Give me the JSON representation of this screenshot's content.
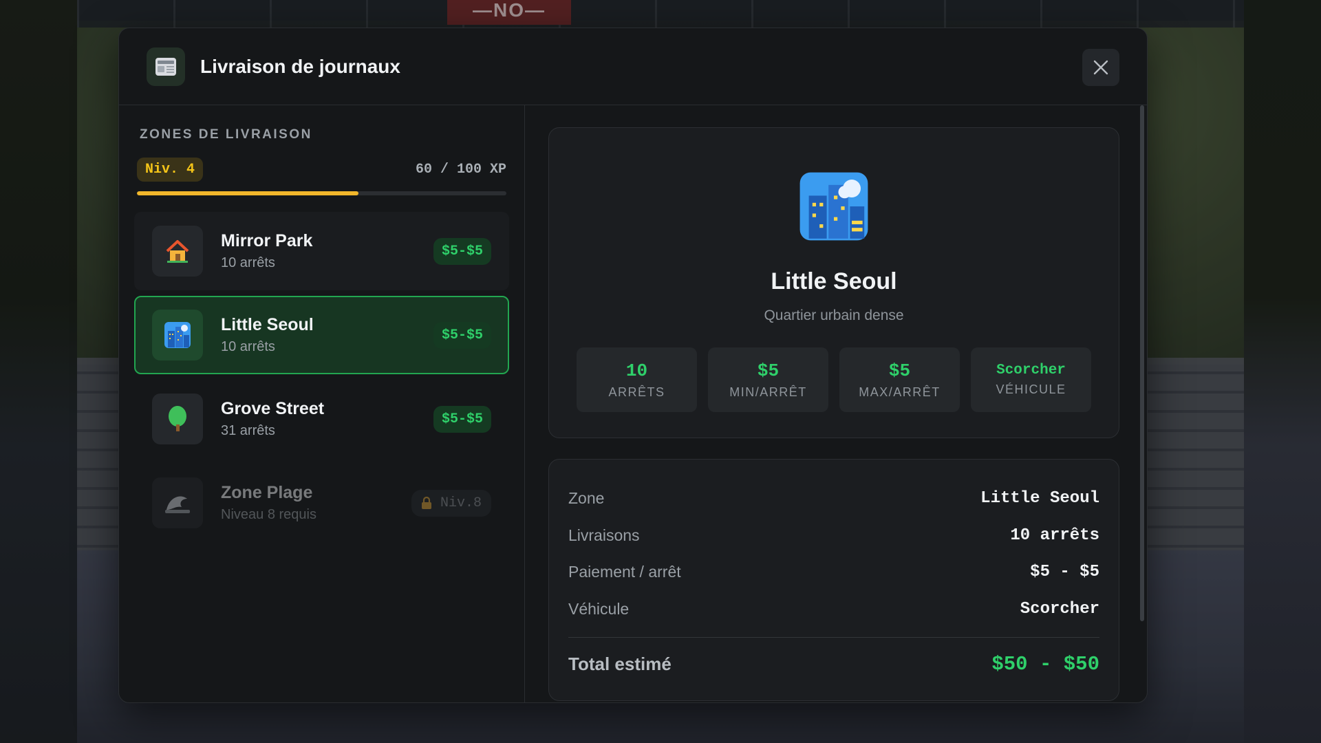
{
  "background": {
    "sign_text": "—NO—"
  },
  "header": {
    "title": "Livraison de journaux",
    "icon": "newspaper-icon",
    "close_icon": "close-icon"
  },
  "left": {
    "section_title": "ZONES DE LIVRAISON",
    "level_badge": "Niv. 4",
    "xp_text": "60 / 100 XP",
    "xp_progress": 0.6,
    "zones": [
      {
        "name": "Mirror Park",
        "sub": "10 arrêts",
        "price": "$5-$5",
        "icon": "house-icon",
        "state": "normal"
      },
      {
        "name": "Little Seoul",
        "sub": "10 arrêts",
        "price": "$5-$5",
        "icon": "city-icon",
        "state": "selected"
      },
      {
        "name": "Grove Street",
        "sub": "31 arrêts",
        "price": "$5-$5",
        "icon": "tree-icon",
        "state": "normal"
      },
      {
        "name": "Zone Plage",
        "sub": "Niveau 8 requis",
        "price": "Niv.8",
        "icon": "wave-icon",
        "state": "locked"
      }
    ]
  },
  "detail": {
    "name": "Little Seoul",
    "description": "Quartier urbain dense",
    "icon": "city-icon",
    "stats": [
      {
        "value": "10",
        "label": "ARRÊTS"
      },
      {
        "value": "$5",
        "label": "MIN/ARRÊT"
      },
      {
        "value": "$5",
        "label": "MAX/ARRÊT"
      },
      {
        "value": "Scorcher",
        "label": "VÉHICULE"
      }
    ]
  },
  "summary": {
    "rows": [
      {
        "label": "Zone",
        "value": "Little Seoul"
      },
      {
        "label": "Livraisons",
        "value": "10 arrêts"
      },
      {
        "label": "Paiement / arrêt",
        "value": "$5 - $5"
      },
      {
        "label": "Véhicule",
        "value": "Scorcher"
      }
    ],
    "total_label": "Total estimé",
    "total_value": "$50 - $50"
  },
  "colors": {
    "accent_green": "#2fd06a",
    "level_yellow": "#f5c518",
    "xp_bar": "#f1b72b"
  }
}
